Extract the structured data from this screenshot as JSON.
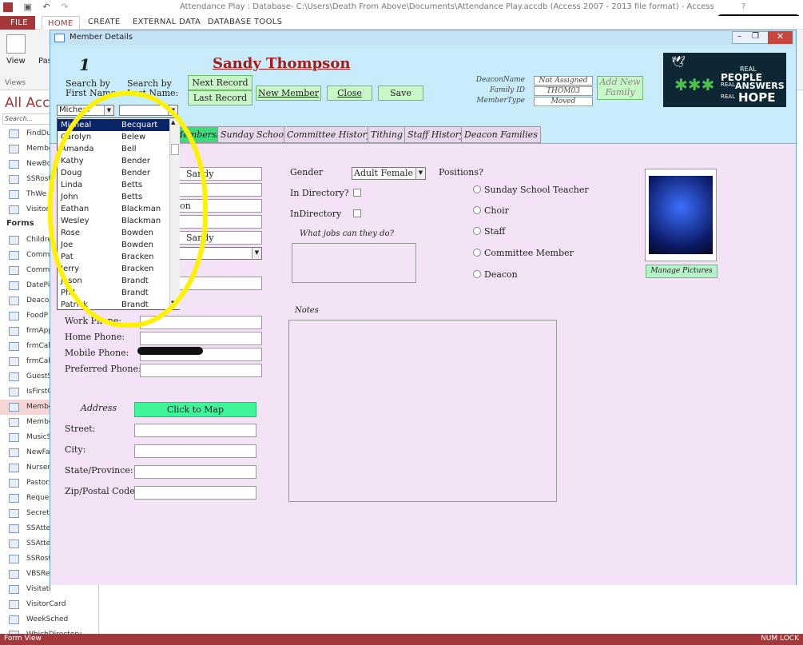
{
  "app": {
    "title": "Attendance Play : Database- C:\\Users\\Death From Above\\Documents\\Attendance Play.accdb (Access 2007 - 2013 file format) - Access",
    "help": "?"
  },
  "ribbon": {
    "tabs": [
      "FILE",
      "HOME",
      "CREATE",
      "EXTERNAL DATA",
      "DATABASE TOOLS"
    ],
    "view_label": "View",
    "paste_label": "Pas",
    "views_group": "Views"
  },
  "nav": {
    "heading": "All Acc",
    "search": "Search...",
    "forms_group": "Forms",
    "items_top": [
      "FindDu",
      "Membe",
      "NewBd",
      "SSRost",
      "ThWe",
      "VisitorQ"
    ],
    "items_forms": [
      "Childre",
      "Commit",
      "Commit",
      "DatePic",
      "Deacon",
      "FoodP",
      "frmApp",
      "frmCale",
      "frmCale",
      "GuestS",
      "IsFirstC",
      "Membe",
      "Membe",
      "MusicS",
      "NewFar",
      "Nursery",
      "Pastors",
      "Reques",
      "Secreta",
      "SSAtter",
      "SSAtter",
      "SSRoste",
      "VBSReg",
      "Visitati",
      "VisitorCard",
      "WeekSched",
      "WhichDirectory"
    ]
  },
  "status": {
    "left": "Form View",
    "right": "NUM LOCK"
  },
  "form": {
    "window_title": "Member Details",
    "record_number": "1",
    "member_name": "Sandy Thompson",
    "search_first_label": "Search by",
    "search_first_sub": "First Name:",
    "search_last_label": "Search by",
    "search_last_sub": "Last Name:",
    "search_first_value": "Micheal",
    "buttons": {
      "next": "Next Record",
      "last": "Last Record",
      "new_member": "New Member",
      "close": "Close",
      "save": "Save",
      "add_family": "Add New Family",
      "click_to_map": "Click to Map",
      "manage_pictures": "Manage Pictures"
    },
    "deacon": {
      "name_label": "DeaconName",
      "name_value": "Not Assigned",
      "family_label": "Family ID",
      "family_value": "THOM03",
      "type_label": "MemberType",
      "type_value": "Moved"
    },
    "logo": {
      "line1": "REAL",
      "line2": "PEOPLE",
      "line3": "REAL",
      "line4": "ANSWERS",
      "line5": "REAL",
      "line6": "HOPE"
    },
    "tabs": [
      "Membership",
      "Sunday School",
      "Committee History",
      "Tithing",
      "Staff History",
      "Deacon Families"
    ],
    "fields": {
      "first": "Sandy",
      "last": "Thompson",
      "nick": "Sandy"
    },
    "labels": {
      "work_phone": "Work Phone:",
      "home_phone": "Home Phone:",
      "mobile_phone": "Mobile Phone:",
      "preferred_phone": "Preferred Phone:",
      "address": "Address",
      "street": "Street:",
      "city": "City:",
      "state": "State/Province:",
      "zip": "Zip/Postal Code:",
      "gender": "Gender",
      "gender_value": "Adult Female",
      "in_directory_q": "In Directory?",
      "in_directory": "InDirectory",
      "jobs": "What jobs can they do?",
      "notes": "Notes",
      "positions": "Positions?"
    },
    "positions": [
      "Sunday School Teacher",
      "Choir",
      "Staff",
      "Committee Member",
      "Deacon"
    ]
  },
  "dropdown": {
    "rows": [
      [
        "Micheal",
        "Becquart"
      ],
      [
        "Carolyn",
        "Belew"
      ],
      [
        "Amanda",
        "Bell"
      ],
      [
        "Kathy",
        "Bender"
      ],
      [
        "Doug",
        "Bender"
      ],
      [
        "Linda",
        "Betts"
      ],
      [
        "John",
        "Betts"
      ],
      [
        "Eathan",
        "Blackman"
      ],
      [
        "Wesley",
        "Blackman"
      ],
      [
        "Rose",
        "Bowden"
      ],
      [
        "Joe",
        "Bowden"
      ],
      [
        "Pat",
        "Bracken"
      ],
      [
        "Jerry",
        "Bracken"
      ],
      [
        "Jason",
        "Brandt"
      ],
      [
        "Phil",
        "Brandt"
      ],
      [
        "Patrick",
        "Brandt"
      ]
    ]
  }
}
